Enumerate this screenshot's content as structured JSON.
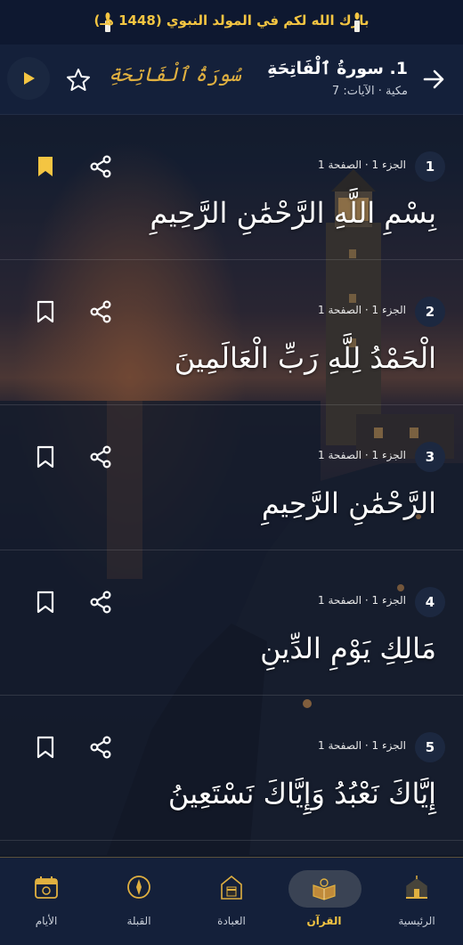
{
  "banner": {
    "text": "بارك الله لكم في المولد النبوي (1448 هـ)"
  },
  "header": {
    "title": "1. سورةُ ٱلْفَاتِحَةِ",
    "meta": "مكية · الآيات: 7",
    "calligraphy": "سُورَةُ ٱلْفَاتِحَةِ"
  },
  "verses": [
    {
      "number": "1",
      "meta": "الجزء 1 · الصفحة 1",
      "text": "بِسْمِ اللَّهِ الرَّحْمَٰنِ الرَّحِيمِ",
      "bookmarked": true
    },
    {
      "number": "2",
      "meta": "الجزء 1 · الصفحة 1",
      "text": "الْحَمْدُ لِلَّهِ رَبِّ الْعَالَمِينَ",
      "bookmarked": false
    },
    {
      "number": "3",
      "meta": "الجزء 1 · الصفحة 1",
      "text": "الرَّحْمَٰنِ الرَّحِيمِ",
      "bookmarked": false
    },
    {
      "number": "4",
      "meta": "الجزء 1 · الصفحة 1",
      "text": "مَالِكِ يَوْمِ الدِّينِ",
      "bookmarked": false
    },
    {
      "number": "5",
      "meta": "الجزء 1 · الصفحة 1",
      "text": "إِيَّاكَ نَعْبُدُ وَإِيَّاكَ نَسْتَعِينُ",
      "bookmarked": false
    }
  ],
  "nav": {
    "home": "الرئيسية",
    "quran": "القرآن",
    "worship": "العبادة",
    "qibla": "القبلة",
    "days": "الأيام"
  },
  "colors": {
    "accent": "#f4c542",
    "gold": "#e0b040",
    "panel": "#14203a"
  },
  "icons": [
    "candle-icon",
    "back-arrow-icon",
    "star-icon",
    "play-icon",
    "bookmark-icon",
    "share-icon",
    "mosque-icon",
    "quran-icon",
    "kaaba-icon",
    "compass-icon",
    "calendar-icon"
  ]
}
